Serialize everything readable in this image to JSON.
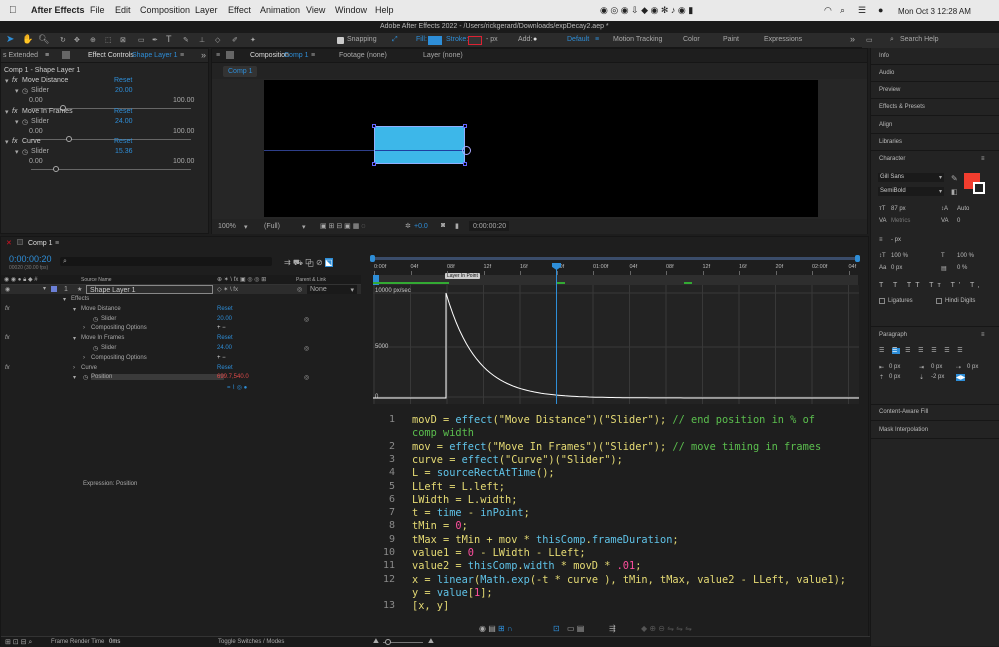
{
  "menubar": {
    "app_name": "After Effects",
    "items": [
      "File",
      "Edit",
      "Composition",
      "Layer",
      "Effect",
      "Animation",
      "View",
      "Window",
      "Help"
    ],
    "window_title": "Adobe After Effects 2022 - /Users/rickgerard/Downloads/expDecay2.aep *",
    "clock": "Mon Oct 3  12:28 AM"
  },
  "toolbar": {
    "snapping": "Snapping",
    "fill": "Fill:",
    "stroke": "Stroke:",
    "stroke_px": "- px",
    "add": "Add:",
    "workspaces": [
      "Default",
      "Motion Tracking",
      "Color",
      "Paint",
      "Expressions"
    ],
    "search_placeholder": "Search Help"
  },
  "effect_controls": {
    "tab_left": "s Extended",
    "tab_title": "Effect Controls",
    "tab_layer": "Shape Layer 1",
    "header": "Comp 1 - Shape Layer 1",
    "effects": [
      {
        "name": "Move Distance",
        "reset": "Reset",
        "slider_label": "Slider",
        "value": "20.00",
        "min": "0.00",
        "max": "100.00",
        "knob": 0.2
      },
      {
        "name": "Move In Frames",
        "reset": "Reset",
        "slider_label": "Slider",
        "value": "24.00",
        "min": "0.00",
        "max": "100.00",
        "knob": 0.24
      },
      {
        "name": "Curve",
        "reset": "Reset",
        "slider_label": "Slider",
        "value": "15.36",
        "min": "0.00",
        "max": "100.00",
        "knob": 0.1536
      }
    ]
  },
  "composition": {
    "tab_title": "Composition",
    "tab_comp": "Comp 1",
    "footage": "Footage (none)",
    "layer": "Layer (none)",
    "sub_tab": "Comp 1",
    "zoom": "100%",
    "resolution": "(Full)",
    "exposure": "+0.0",
    "timecode": "0:00:00:20",
    "shape_color": "#3db7e9"
  },
  "timeline": {
    "tab": "Comp 1",
    "timecode": "0:00:00:20",
    "timecode_sub": "00020 (30.00 fps)",
    "search_placeholder": "",
    "col_source": "Source Name",
    "col_parent": "Parent & Link",
    "ruler": [
      "0:00f",
      "04f",
      "08f",
      "12f",
      "16f",
      "20f",
      "01:00f",
      "04f",
      "08f",
      "12f",
      "16f",
      "20f",
      "02:00f",
      "04f"
    ],
    "in_point_label": "Layer In Point",
    "graph_labels": [
      "10000 px/sec",
      "5000",
      "0"
    ],
    "layer": {
      "number": "1",
      "name": "Shape Layer 1",
      "parent": "None"
    },
    "tree": [
      {
        "label": "Effects",
        "indent": 0,
        "reset": ""
      },
      {
        "label": "Move Distance",
        "indent": 1,
        "reset": "Reset"
      },
      {
        "label": "Slider",
        "indent": 2,
        "value": "20.00"
      },
      {
        "label": "Compositing Options",
        "indent": 2,
        "value": "+ −"
      },
      {
        "label": "Move In Frames",
        "indent": 1,
        "reset": "Reset"
      },
      {
        "label": "Slider",
        "indent": 2,
        "value": "24.00"
      },
      {
        "label": "Compositing Options",
        "indent": 2,
        "value": "+ −"
      },
      {
        "label": "Curve",
        "indent": 1,
        "reset": "Reset"
      },
      {
        "label": "Position",
        "indent": 1,
        "value": "699.7,540.0"
      }
    ],
    "expression_label": "Expression: Position",
    "footer_render": "Frame Render Time",
    "footer_render_value": "0ms",
    "footer_toggle": "Toggle Switches / Modes"
  },
  "code_lines": [
    {
      "n": "1",
      "html": "<span class='st'>movD = </span><span class='fn'>effect</span><span class='st'>(\"Move Distance\")(\"Slider\"); </span><span class='cm'>// end position in % of</span>"
    },
    {
      "n": "",
      "html": "<span class='cm'>comp width</span>"
    },
    {
      "n": "2",
      "html": "<span class='st'>mov = </span><span class='fn'>effect</span><span class='st'>(\"Move In Frames\")(\"Slider\"); </span><span class='cm'>// move timing in frames</span>"
    },
    {
      "n": "3",
      "html": "<span class='st'>curve = </span><span class='fn'>effect</span><span class='st'>(\"Curve\")(\"Slider\");</span>"
    },
    {
      "n": "4",
      "html": "<span class='st'>L = </span><span class='fn'>sourceRectAtTime</span><span class='st'>();</span>"
    },
    {
      "n": "5",
      "html": "<span class='st'>LLeft = L.left;</span>"
    },
    {
      "n": "6",
      "html": "<span class='st'>LWidth = L.width;</span>"
    },
    {
      "n": "7",
      "html": "<span class='st'>t = </span><span class='fn'>time</span><span class='st'> - </span><span class='fn'>inPoint</span><span class='st'>;</span>"
    },
    {
      "n": "8",
      "html": "<span class='st'>tMin = </span><span class='nm'>0</span><span class='st'>;</span>"
    },
    {
      "n": "9",
      "html": "<span class='st'>tMax = tMin + mov * </span><span class='fn'>thisComp</span><span class='st'>.</span><span class='fn'>frameDuration</span><span class='st'>;</span>"
    },
    {
      "n": "10",
      "html": "<span class='st'>value1 = </span><span class='nm'>0</span><span class='st'> - LWidth - LLeft;</span>"
    },
    {
      "n": "11",
      "html": "<span class='st'>value2 = </span><span class='fn'>thisComp</span><span class='st'>.</span><span class='fn'>width</span><span class='st'> * movD * </span><span class='nm'>.01</span><span class='st'>;</span>"
    },
    {
      "n": "12",
      "html": "<span class='st'>x = </span><span class='fn'>linear</span><span class='st'>(</span><span class='fn'>Math.exp</span><span class='st'>(-t * curve ), tMin, tMax, value2 - LLeft, value1);</span>"
    },
    {
      "n": "",
      "html": "<span class='st'>y = </span><span class='fn'>value</span><span class='st'>[</span><span class='nm'>1</span><span class='st'>];</span>"
    },
    {
      "n": "13",
      "html": "<span class='st'>[x, y]</span>"
    }
  ],
  "right_panel": {
    "items": [
      "Info",
      "Audio",
      "Preview",
      "Effects & Presets",
      "Align",
      "Libraries"
    ],
    "character_title": "Character",
    "font": "Gill Sans",
    "style": "SemiBold",
    "size": "87 px",
    "leading": "Auto",
    "kerning": "Metrics",
    "tracking": "0",
    "stroke": "- px",
    "vscale": "100 %",
    "hscale": "100 %",
    "baseline": "0 px",
    "tsume": "0 %",
    "ligatures": "Ligatures",
    "hindi": "Hindi Digits",
    "fill_color": "#f23d2e",
    "paragraph_title": "Paragraph",
    "para_values": [
      "0 px",
      "0 px",
      "0 px",
      "0 px",
      "-2 px",
      "0 px"
    ],
    "bottom_items": [
      "Content-Aware Fill",
      "Mask Interpolation"
    ]
  }
}
